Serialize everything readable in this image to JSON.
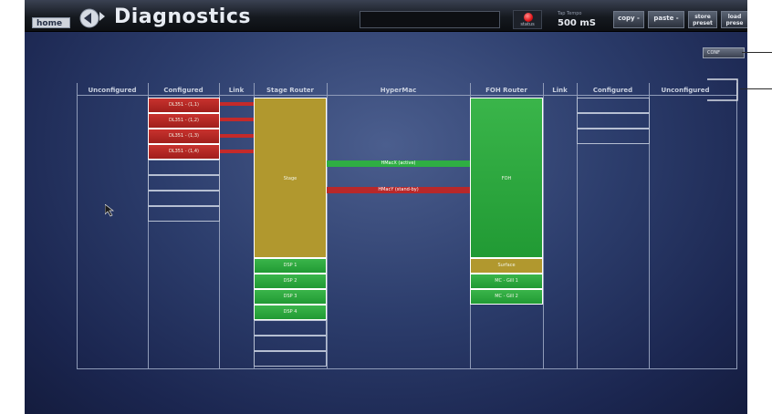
{
  "topbar": {
    "home_label": "home",
    "title": "Diagnostics",
    "status_label": "status",
    "tap_tempo_label": "Tap Tempo",
    "tap_tempo_value": "500 mS",
    "copy_label": "copy -",
    "paste_label": "paste -",
    "store_preset_label": "store preset",
    "load_preset_label": "load prese"
  },
  "config_button": {
    "label": "CONF"
  },
  "columns": [
    "Unconfigured",
    "Configured",
    "Link",
    "Stage Router",
    "HyperMac",
    "FOH Router",
    "Link",
    "Configured",
    "Unconfigured"
  ],
  "left_configured": [
    "DL351 - (1,1)",
    "DL351 - (1,2)",
    "DL351 - (1,3)",
    "DL351 - (1,4)"
  ],
  "stage_router": {
    "main": "Stage",
    "dsp": [
      "DSP 1",
      "DSP 2",
      "DSP 3",
      "DSP 4"
    ]
  },
  "hypermac": {
    "active": "HMacX (active)",
    "standby": "HMacY (stand-by)"
  },
  "foh_router": {
    "main": "FOH",
    "surface": "Surface",
    "mc": [
      "MC - Gill 1",
      "MC - Gill 2"
    ]
  },
  "colors": {
    "red": "#c8322e",
    "green": "#3ab54a",
    "olive": "#b1982e",
    "accent_led": "#e0161a"
  },
  "icons": {
    "nav": "back-forward-arrows-icon",
    "status": "status-led-icon",
    "cursor": "mouse-pointer-icon"
  }
}
